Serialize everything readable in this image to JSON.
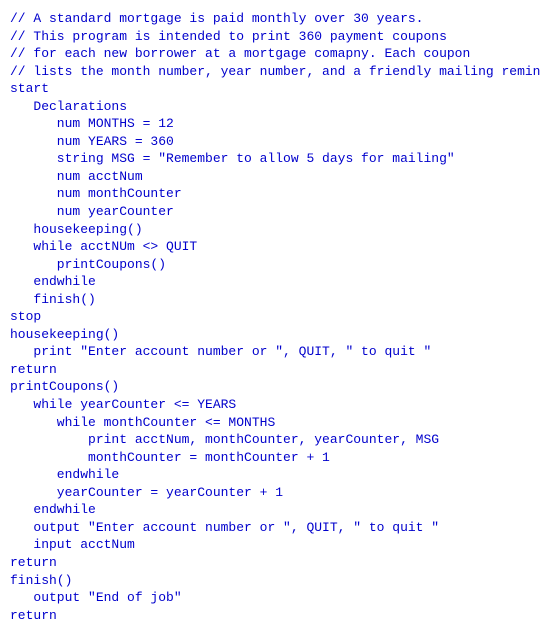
{
  "code": {
    "lines": [
      "// A standard mortgage is paid monthly over 30 years.",
      "// This program is intended to print 360 payment coupons",
      "// for each new borrower at a mortgage comapny. Each coupon",
      "// lists the month number, year number, and a friendly mailing reminder.",
      "start",
      "   Declarations",
      "      num MONTHS = 12",
      "      num YEARS = 360",
      "      string MSG = \"Remember to allow 5 days for mailing\"",
      "      num acctNum",
      "      num monthCounter",
      "      num yearCounter",
      "   housekeeping()",
      "   while acctNUm <> QUIT",
      "      printCoupons()",
      "   endwhile",
      "   finish()",
      "stop",
      "",
      "housekeeping()",
      "   print \"Enter account number or \", QUIT, \" to quit \"",
      "return",
      "",
      "printCoupons()",
      "   while yearCounter <= YEARS",
      "      while monthCounter <= MONTHS",
      "          print acctNum, monthCounter, yearCounter, MSG",
      "          monthCounter = monthCounter + 1",
      "      endwhile",
      "      yearCounter = yearCounter + 1",
      "   endwhile",
      "   output \"Enter account number or \", QUIT, \" to quit \"",
      "   input acctNum",
      "return",
      "",
      "finish()",
      "   output \"End of job\"",
      "return"
    ]
  }
}
